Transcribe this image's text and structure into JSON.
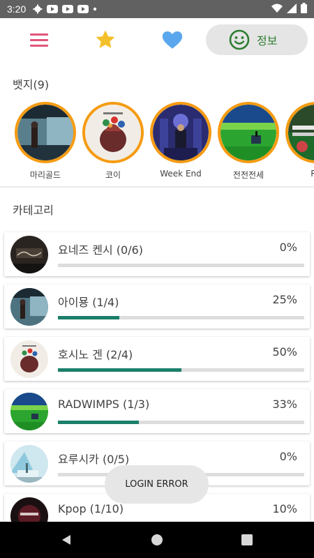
{
  "status_bar": {
    "time": "3:20",
    "icons": [
      "gear-icon",
      "youtube-icon",
      "youtube-icon",
      "youtube-icon",
      "dot-icon"
    ],
    "right_icons": [
      "wifi-icon",
      "signal-icon",
      "battery-icon"
    ]
  },
  "toolbar": {
    "menu_icon": "hamburger-menu-icon",
    "favorites_icon": "star-icon",
    "likes_icon": "heart-icon",
    "info_label": "정보",
    "info_icon": "smiley-icon",
    "colors": {
      "menu": "#e0557d",
      "star": "#f4c02a",
      "heart": "#5aa7ee",
      "info": "#2e7d32"
    }
  },
  "badges_section": {
    "title": "뱃지(9)",
    "items": [
      {
        "name": "마리골드"
      },
      {
        "name": "코이"
      },
      {
        "name": "Week End"
      },
      {
        "name": "전전전세"
      },
      {
        "name": "Ra"
      }
    ],
    "ring_color": "#f59b12"
  },
  "category_section": {
    "title": "카테고리",
    "items": [
      {
        "title": "요네즈 켄시 (0/6)",
        "percent_text": "0%",
        "progress": 0
      },
      {
        "title": "아이묭 (1/4)",
        "percent_text": "25%",
        "progress": 0.25
      },
      {
        "title": "호시노 겐 (2/4)",
        "percent_text": "50%",
        "progress": 0.5
      },
      {
        "title": "RADWIMPS (1/3)",
        "percent_text": "33%",
        "progress": 0.33
      },
      {
        "title": "요루시카 (0/5)",
        "percent_text": "0%",
        "progress": 0
      },
      {
        "title": "Kpop (1/10)",
        "percent_text": "10%",
        "progress": 0.1
      }
    ],
    "progress_color": "#1b7f6a"
  },
  "toast": {
    "text": "LOGIN ERROR"
  },
  "nav_bar": {
    "back_icon": "back-triangle-icon",
    "home_icon": "home-circle-icon",
    "recents_icon": "recents-square-icon"
  }
}
